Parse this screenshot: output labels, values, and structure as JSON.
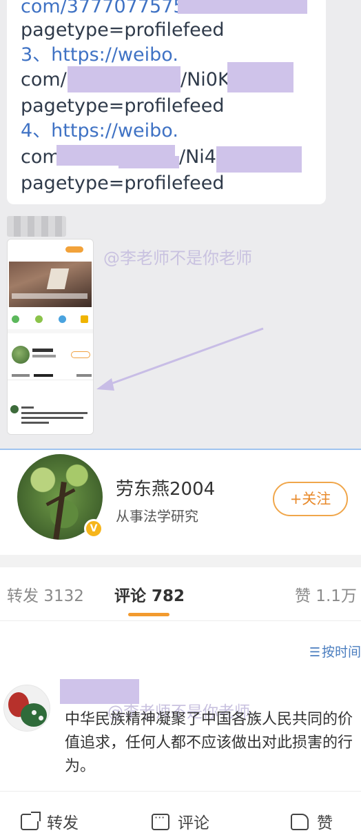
{
  "chat": {
    "lines": [
      "com/",
      "pagetype=profilefeed",
      "3、https://weibo.",
      "com/",
      "/Ni0K",
      "pagetype=profilefeed",
      "4、https://weibo.",
      "com",
      "/Ni4",
      "pagetype=profilefeed"
    ],
    "top_fragment": "com/3777077575",
    "watermark": "@李老师不是你老师"
  },
  "profile": {
    "name": "劳东燕2004",
    "description": "从事法学研究",
    "verified_badge": "V",
    "follow_label": "+关注"
  },
  "tabs": [
    {
      "label": "转发 3132"
    },
    {
      "label": "评论 782"
    },
    {
      "label": "赞 1.1万"
    }
  ],
  "sort": {
    "icon": "sort-icon",
    "label": "按时间"
  },
  "comment": {
    "text": "中华民族精神凝聚了中国各族人民共同的价值追求，任何人都不应该做出对此损害的行为。",
    "watermark": "@李老师不是你老师"
  },
  "actions": {
    "share": "转发",
    "comment": "评论",
    "like": "赞"
  },
  "colors": {
    "accent_orange": "#f29a2e",
    "link_blue": "#3f72c4",
    "redaction_purple": "#cfc3ea"
  }
}
